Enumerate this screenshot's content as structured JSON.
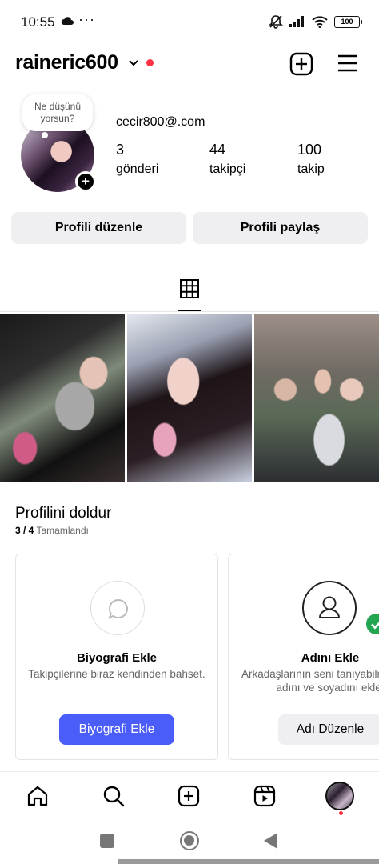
{
  "status_bar": {
    "time": "10:55",
    "dots": "···",
    "battery": "100"
  },
  "header": {
    "username": "raineric600",
    "chevron_icon": "chevron-down-icon",
    "add_icon": "plus-square-icon",
    "menu_icon": "hamburger-menu-icon",
    "notif_color": "#ff3040"
  },
  "profile": {
    "note_bubble": "Ne düşünü yorsun?",
    "display_name": "cecir800@.com",
    "stats": {
      "posts": {
        "count": "3",
        "label": "gönderi"
      },
      "followers": {
        "count": "44",
        "label": "takipçi"
      },
      "following": {
        "count": "100",
        "label": "takip"
      }
    },
    "buttons": {
      "edit": "Profili düzenle",
      "share": "Profili paylaş"
    }
  },
  "tabs": {
    "grid_icon": "grid-icon"
  },
  "complete_profile": {
    "title": "Profilini doldur",
    "progress_count": "3 / 4",
    "progress_label": "Tamamlandı",
    "cards": [
      {
        "title": "Biyografi Ekle",
        "desc": "Takipçilerine biraz kendinden bahset.",
        "button": "Biyografi Ekle",
        "icon": "speech-bubble-icon"
      },
      {
        "title": "Adını Ekle",
        "desc": "Arkadaşlarının seni tanıyabilmesi için adını ve soyadını ekle.",
        "button": "Adı Düzenle",
        "icon": "user-icon",
        "completed": true
      }
    ]
  },
  "bottom_nav": {
    "items": [
      "home-icon",
      "search-icon",
      "create-icon",
      "reels-icon",
      "profile-avatar"
    ]
  },
  "colors": {
    "primary_button": "#4a5df9",
    "secondary_button": "#efeff2",
    "success": "#23a552"
  }
}
